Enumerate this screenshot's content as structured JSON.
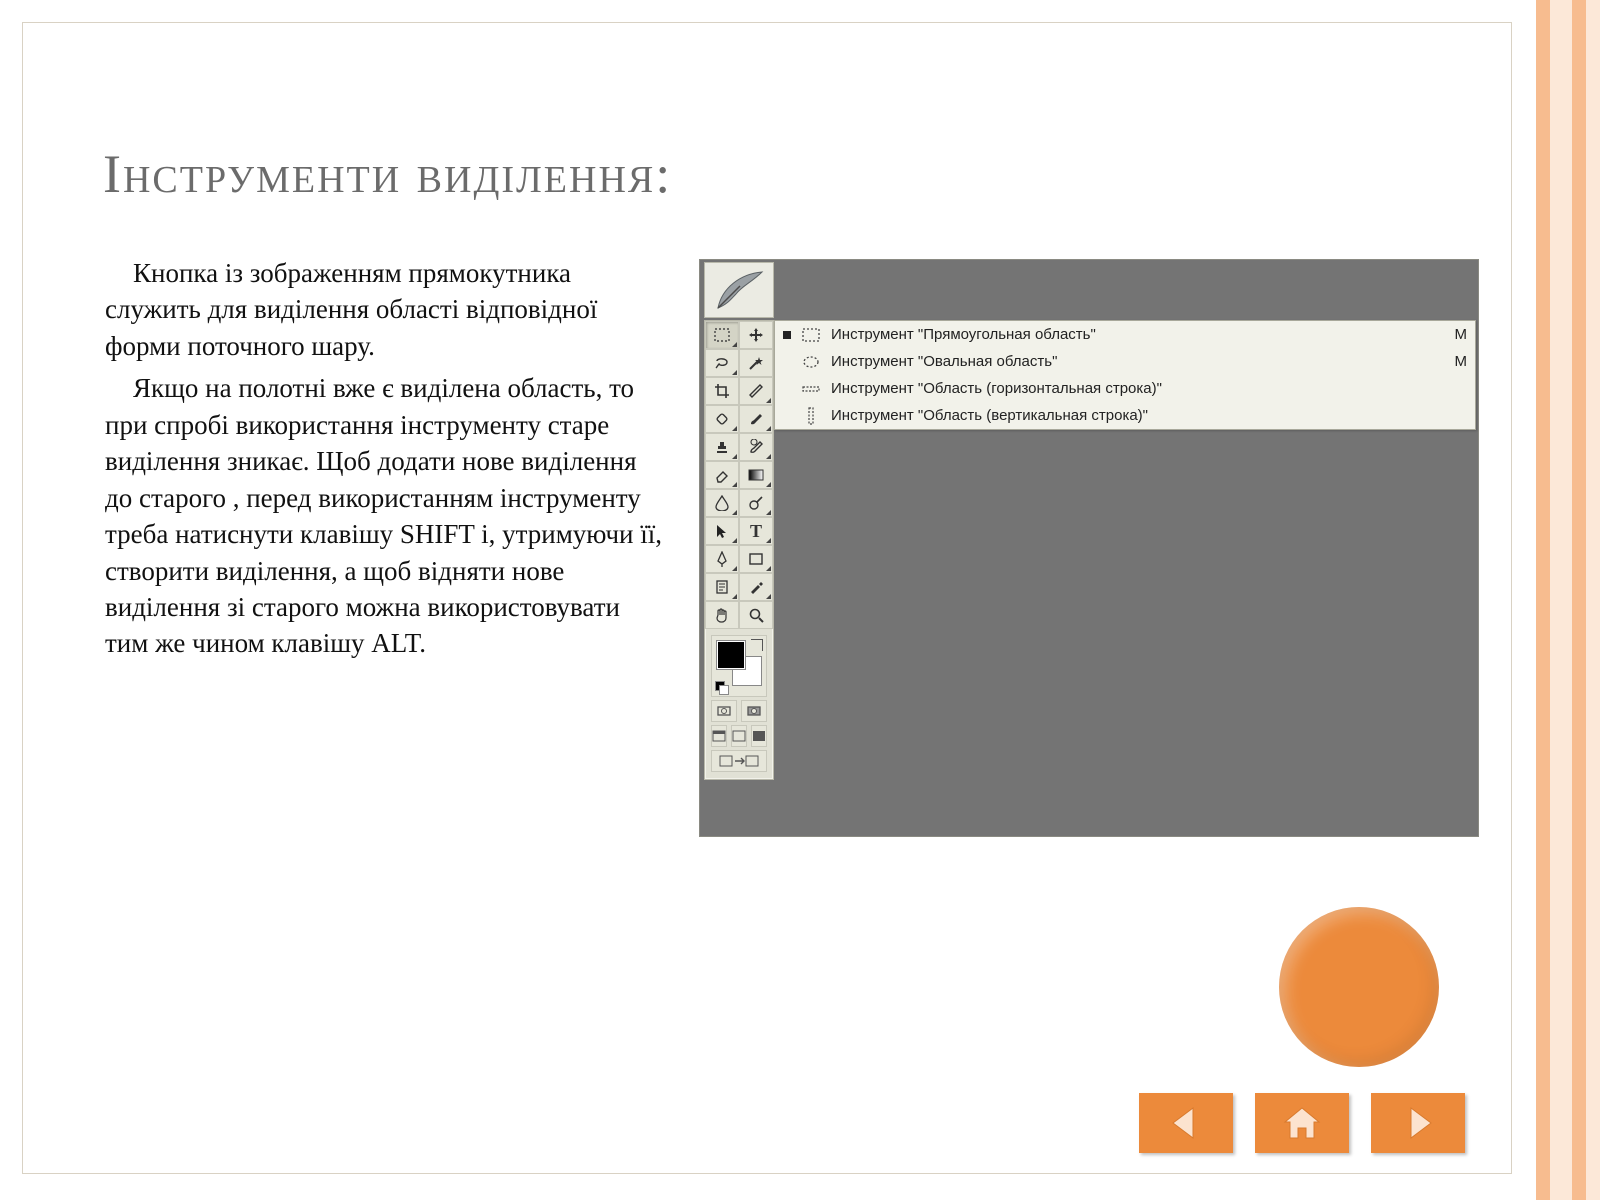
{
  "slide": {
    "title": "Інструменти виділення:",
    "paragraph1": "Кнопка із зображенням прямокутника служить для виділення області відповідної форми поточного шару.",
    "paragraph2": "Якщо на полотні вже є виділена область, то при спробі використання інструменту старе виділення зникає. Щоб додати нове виділення до старого , перед використанням інструменту треба натиснути клавішу SHIFT і, утримуючи її, створити виділення, а щоб відняти нове виділення зі старого можна використовувати тим же чином клавішу ALT."
  },
  "flyout": {
    "items": [
      {
        "label": "Инструмент \"Прямоугольная область\"",
        "key": "M",
        "selected": true
      },
      {
        "label": "Инструмент \"Овальная область\"",
        "key": "M",
        "selected": false
      },
      {
        "label": "Инструмент \"Область (горизонтальная строка)\"",
        "key": "",
        "selected": false
      },
      {
        "label": "Инструмент \"Область (вертикальная строка)\"",
        "key": "",
        "selected": false
      }
    ]
  }
}
